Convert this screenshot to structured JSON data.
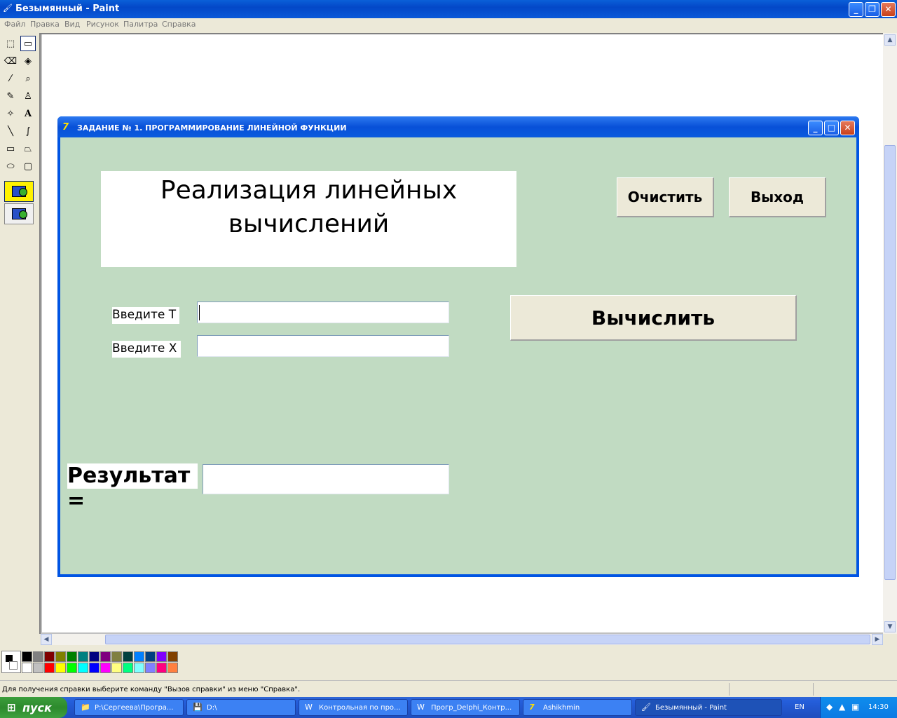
{
  "window": {
    "title": "Безымянный - Paint",
    "minimize": "_",
    "maximize": "❐",
    "close": "✕"
  },
  "menu": [
    "Файл",
    "Правка",
    "Вид",
    "Рисунок",
    "Палитра",
    "Справка"
  ],
  "tools": [
    {
      "name": "free-select-icon",
      "glyph": "⬚"
    },
    {
      "name": "rect-select-icon",
      "glyph": "▭"
    },
    {
      "name": "eraser-icon",
      "glyph": "⌫"
    },
    {
      "name": "fill-icon",
      "glyph": "◈"
    },
    {
      "name": "color-picker-icon",
      "glyph": "⁄"
    },
    {
      "name": "magnifier-icon",
      "glyph": "🔍"
    },
    {
      "name": "pencil-icon",
      "glyph": "✎"
    },
    {
      "name": "brush-icon",
      "glyph": "♙"
    },
    {
      "name": "airbrush-icon",
      "glyph": "✧"
    },
    {
      "name": "text-icon",
      "glyph": "A"
    },
    {
      "name": "line-icon",
      "glyph": "╲"
    },
    {
      "name": "curve-icon",
      "glyph": "∫"
    },
    {
      "name": "rectangle-icon",
      "glyph": "▭"
    },
    {
      "name": "polygon-icon",
      "glyph": "⏢"
    },
    {
      "name": "ellipse-icon",
      "glyph": "⬭"
    },
    {
      "name": "rounded-rect-icon",
      "glyph": "▢"
    }
  ],
  "form": {
    "title": "ЗАДАНИЕ № 1. ПРОГРАММИРОВАНИЕ ЛИНЕЙНОЙ ФУНКЦИИ",
    "icon": "7",
    "heading_line1": "Реализация линейных",
    "heading_line2": "вычислений",
    "clear_button": "Очистить",
    "exit_button": "Выход",
    "calc_button": "Вычислить",
    "label_t": "Введите T",
    "label_x": "Введите X",
    "input_t": "",
    "input_x": "",
    "result_label": "Результат =",
    "result_value": ""
  },
  "palette": {
    "colors_top": [
      "#000000",
      "#808080",
      "#800000",
      "#808000",
      "#008000",
      "#008080",
      "#000080",
      "#800080",
      "#808040",
      "#004040",
      "#0080ff",
      "#004080",
      "#8000ff",
      "#804000"
    ],
    "colors_bottom": [
      "#ffffff",
      "#c0c0c0",
      "#ff0000",
      "#ffff00",
      "#00ff00",
      "#00ffff",
      "#0000ff",
      "#ff00ff",
      "#ffff80",
      "#00ff80",
      "#80ffff",
      "#8080ff",
      "#ff0080",
      "#ff8040"
    ]
  },
  "status": {
    "text": "Для получения справки выберите команду \"Вызов справки\" из меню \"Справка\"."
  },
  "taskbar": {
    "start": "пуск",
    "tasks": [
      {
        "label": "P:\\Сергеева\\Програ...",
        "icon": "📁"
      },
      {
        "label": "D:\\",
        "icon": "💾"
      },
      {
        "label": "Контрольная по про...",
        "icon": "W"
      },
      {
        "label": "Прогр_Delphi_Контр...",
        "icon": "W"
      },
      {
        "label": "Ashikhmin",
        "icon": "7"
      },
      {
        "label": "Безымянный - Paint",
        "icon": "🖌"
      }
    ],
    "lang": "EN",
    "clock": "14:30"
  }
}
